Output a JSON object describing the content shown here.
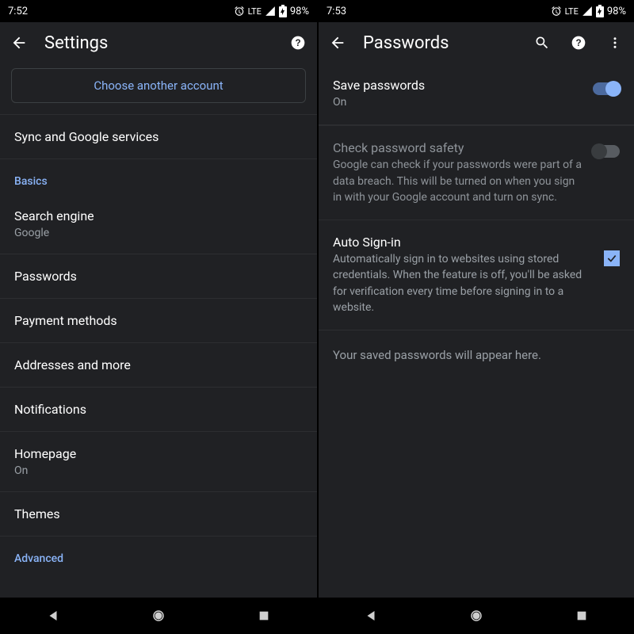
{
  "left": {
    "status": {
      "time": "7:52",
      "lte": "LTE",
      "battery": "98%"
    },
    "title": "Settings",
    "choose_account": "Choose another account",
    "sync": "Sync and Google services",
    "section_basics": "Basics",
    "rows": {
      "search_engine": {
        "title": "Search engine",
        "sub": "Google"
      },
      "passwords": {
        "title": "Passwords"
      },
      "payment": {
        "title": "Payment methods"
      },
      "addresses": {
        "title": "Addresses and more"
      },
      "notifications": {
        "title": "Notifications"
      },
      "homepage": {
        "title": "Homepage",
        "sub": "On"
      },
      "themes": {
        "title": "Themes"
      }
    },
    "section_advanced": "Advanced"
  },
  "right": {
    "status": {
      "time": "7:53",
      "lte": "LTE",
      "battery": "98%"
    },
    "title": "Passwords",
    "save_passwords": {
      "title": "Save passwords",
      "sub": "On"
    },
    "check_safety": {
      "title": "Check password safety",
      "desc": "Google can check if your passwords were part of a data breach. This will be turned on when you sign in with your Google account and turn on sync."
    },
    "auto_signin": {
      "title": "Auto Sign-in",
      "desc": "Automatically sign in to websites using stored credentials. When the feature is off, you'll be asked for verification every time before signing in to a website."
    },
    "empty": "Your saved passwords will appear here."
  }
}
